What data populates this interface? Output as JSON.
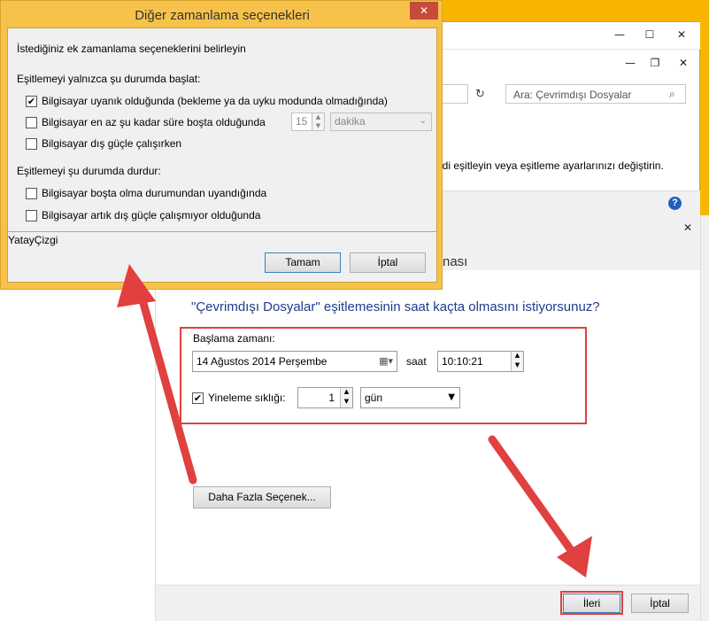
{
  "background_window": {
    "back_button_label": "İleri",
    "search": {
      "placeholder": "Ara: Çevrimdışı Dosyalar",
      "value": ""
    },
    "info_text": "ndi eşitleyin veya eşitleme ayarlarınızı değiştirin."
  },
  "wizard": {
    "title_fragment": "nası",
    "question": "\"Çevrimdışı Dosyalar\" eşitlemesinin saat kaçta olmasını istiyorsunuz?",
    "start_label": "Başlama zamanı:",
    "date_value": "14  Ağustos  2014 Perşembe",
    "time_label": "saat",
    "time_value": "10:10:21",
    "repeat_label": "Yineleme sıklığı:",
    "repeat_value": "1",
    "repeat_unit": "gün",
    "more_options_label": "Daha Fazla Seçenek...",
    "next_label": "İleri",
    "cancel_label": "İptal"
  },
  "dialog": {
    "title": "Diğer zamanlama seçenekleri",
    "intro": "İstediğiniz ek zamanlama seçeneklerini belirleyin",
    "start_heading": "Eşitlemeyi yalnızca şu durumda başlat:",
    "start_options": [
      {
        "label": "Bilgisayar uyanık olduğunda (bekleme ya da uyku modunda olmadığında)",
        "checked": true
      },
      {
        "label": "Bilgisayar en az şu kadar süre boşta olduğunda",
        "checked": false
      },
      {
        "label": "Bilgisayar dış güçle çalışırken",
        "checked": false
      }
    ],
    "idle_value": "15",
    "idle_unit": "dakika",
    "stop_heading": "Eşitlemeyi şu durumda durdur:",
    "stop_options": [
      {
        "label": "Bilgisayar boşta olma durumundan uyandığında",
        "checked": false
      },
      {
        "label": "Bilgisayar artık dış güçle çalışmıyor olduğunda",
        "checked": false
      }
    ],
    "separator_label": "YatayÇizgi",
    "ok_label": "Tamam",
    "cancel_label": "İptal"
  },
  "colors": {
    "annotation_red": "#e04040",
    "dialog_frame": "#f7c24a",
    "question_blue": "#1e3c8c"
  }
}
